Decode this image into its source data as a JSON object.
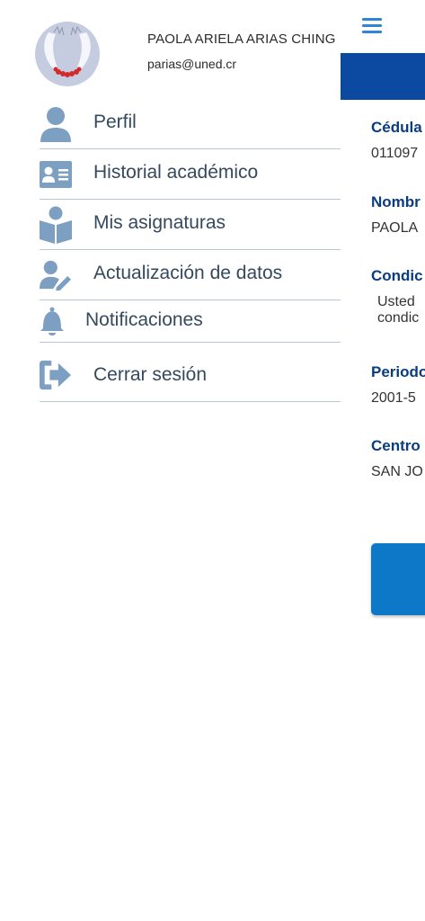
{
  "user": {
    "name": "PAOLA ARIELA ARIAS CHING",
    "email": "parias@uned.cr"
  },
  "menu": [
    {
      "label": "Perfil",
      "icon": "user-icon"
    },
    {
      "label": "Historial académico",
      "icon": "id-card-icon"
    },
    {
      "label": "Mis asignaturas",
      "icon": "reading-book-icon"
    },
    {
      "label": "Actualización de datos",
      "icon": "user-edit-icon"
    },
    {
      "label": "Notificaciones",
      "icon": "bell-icon"
    },
    {
      "label": "Cerrar sesión",
      "icon": "sign-out-icon"
    }
  ],
  "content": {
    "fields": [
      {
        "label": "Cédula",
        "value": "011097"
      },
      {
        "label": "Nombr",
        "value": "PAOLA"
      },
      {
        "label": "Condic",
        "value": "Usted",
        "value2": "condic"
      },
      {
        "label": "Periodo",
        "value": "2001-5"
      },
      {
        "label": "Centro",
        "value": "SAN JO"
      }
    ]
  },
  "colors": {
    "icon": "#7d9fc1",
    "label": "#34495e",
    "divider": "#b9c7d3",
    "header_bar": "#0b4aa0",
    "field_label": "#0a3d80",
    "button": "#0e78c8",
    "hamburger": "#2f86d7"
  }
}
